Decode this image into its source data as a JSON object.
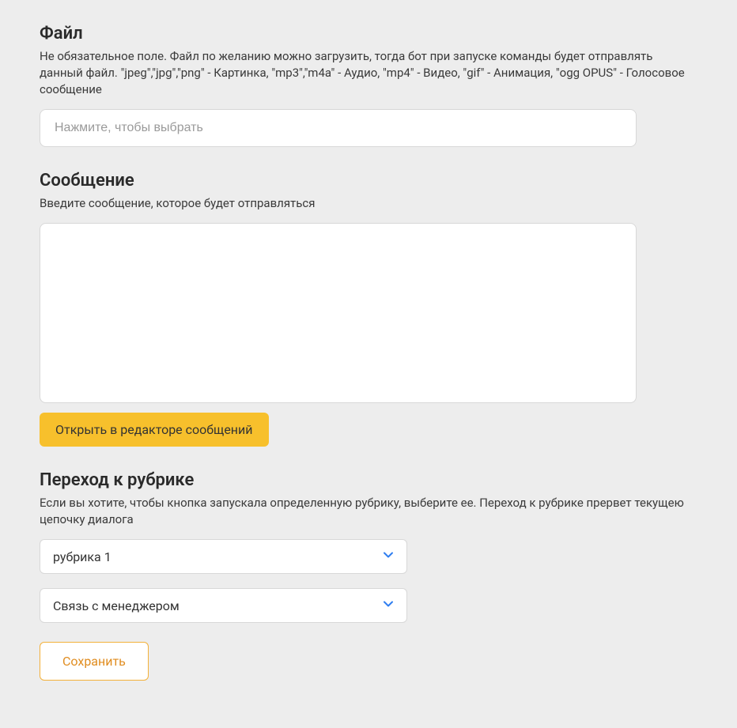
{
  "file": {
    "title": "Файл",
    "desc": "Не обязательное поле. Файл по желанию можно загрузить, тогда бот при запуске команды будет отправлять данный файл. \"jpeg\",\"jpg\",\"png\" - Картинка, \"mp3\",\"m4a\" - Аудио, \"mp4\" - Видео, \"gif\" - Анимация, \"ogg OPUS\" - Голосовое сообщение",
    "placeholder": "Нажмите, чтобы выбрать"
  },
  "message": {
    "title": "Сообщение",
    "desc": "Введите сообщение, которое будет отправляться",
    "value": "",
    "editor_button": "Открыть в редакторе сообщений"
  },
  "rubric": {
    "title": "Переход к рубрике",
    "desc": "Если вы хотите, чтобы кнопка запускала определенную рубрику, выберите ее. Переход к рубрике прервет текущею цепочку диалога",
    "select1": "рубрика 1",
    "select2": "Связь с менеджером"
  },
  "save_button": "Сохранить"
}
